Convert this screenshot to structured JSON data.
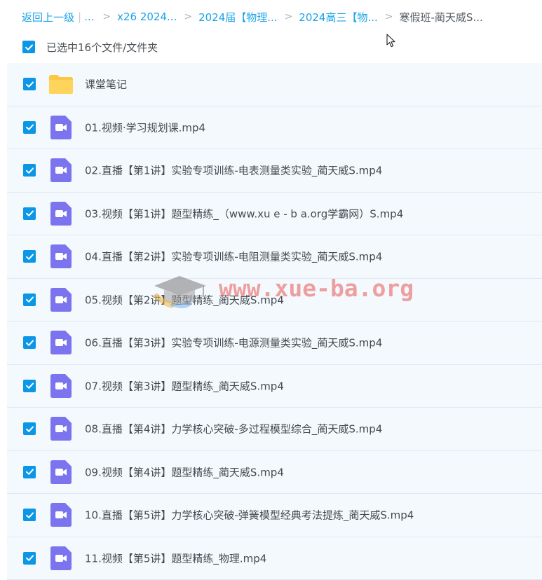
{
  "breadcrumb": {
    "back_label": "返回上一级",
    "separator": "|",
    "more_label": "...",
    "arrow": ">",
    "items": [
      {
        "label": "x26 2024..."
      },
      {
        "label": "2024届【物理..."
      },
      {
        "label": "2024高三【物..."
      }
    ],
    "current": "寒假班-蔺天威S..."
  },
  "selection": {
    "checked": true,
    "text": "已选中16个文件/文件夹"
  },
  "files": [
    {
      "name": "课堂笔记",
      "type": "folder",
      "checked": true
    },
    {
      "name": "01.视频·学习规划课.mp4",
      "type": "video",
      "checked": true
    },
    {
      "name": "02.直播【第1讲】实验专项训练-电表测量类实验_蔺天威S.mp4",
      "type": "video",
      "checked": true
    },
    {
      "name": "03.视频【第1讲】题型精练_（www.xu e - b a.org学霸网）S.mp4",
      "type": "video",
      "checked": true
    },
    {
      "name": "04.直播【第2讲】实验专项训练-电阻测量类实验_蔺天威S.mp4",
      "type": "video",
      "checked": true
    },
    {
      "name": "05.视频【第2讲】题型精练_蔺天威S.mp4",
      "type": "video",
      "checked": true
    },
    {
      "name": "06.直播【第3讲】实验专项训练-电源测量类实验_蔺天威S.mp4",
      "type": "video",
      "checked": true
    },
    {
      "name": "07.视频【第3讲】题型精练_蔺天威S.mp4",
      "type": "video",
      "checked": true
    },
    {
      "name": "08.直播【第4讲】力学核心突破-多过程模型综合_蔺天威S.mp4",
      "type": "video",
      "checked": true
    },
    {
      "name": "09.视频【第4讲】题型精练_蔺天威S.mp4",
      "type": "video",
      "checked": true
    },
    {
      "name": "10.直播【第5讲】力学核心突破-弹簧模型经典考法提炼_蔺天威S.mp4",
      "type": "video",
      "checked": true
    },
    {
      "name": "11.视频【第5讲】题型精练_物理.mp4",
      "type": "video",
      "checked": true
    }
  ],
  "watermark": {
    "text": "www.xue-ba.org"
  },
  "colors": {
    "accent": "#0b97e6",
    "link": "#1aa3e8",
    "row_bg": "#f4f9fe",
    "video_icon": "#7c74ee",
    "folder_icon": "#fcc842"
  },
  "icons": {
    "folder": "folder-icon",
    "video": "video-file-icon",
    "checkbox": "checkmark-icon",
    "cursor": "mouse-cursor-icon"
  }
}
